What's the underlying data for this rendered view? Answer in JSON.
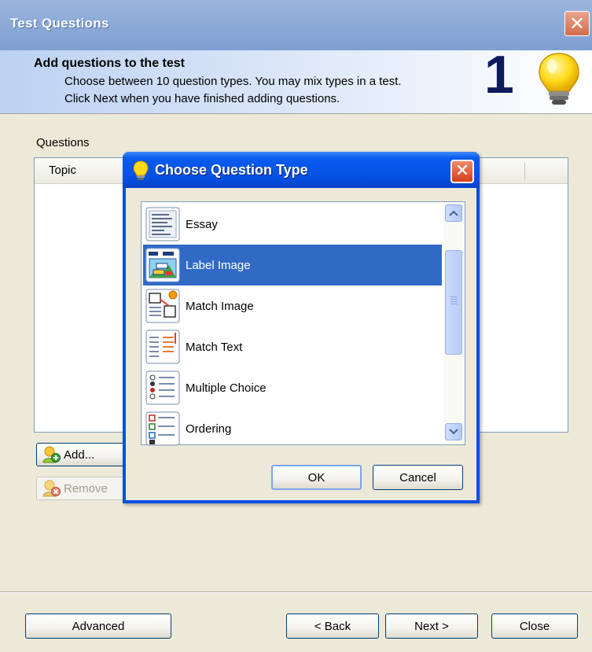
{
  "window": {
    "title": "Test Questions",
    "close_glyph": "✕"
  },
  "header": {
    "title": "Add questions to the test",
    "line1": "Choose between 10 question types. You may mix types in a test.",
    "line2": "Click Next when you have finished adding questions.",
    "step": "1",
    "icon": "lightbulb-icon"
  },
  "questions": {
    "label": "Questions",
    "columns": [
      "Topic"
    ]
  },
  "buttons": {
    "add": "Add...",
    "remove": "Remove",
    "advanced": "Advanced",
    "back": "< Back",
    "next": "Next >",
    "close": "Close"
  },
  "dialog": {
    "title": "Choose Question Type",
    "close_glyph": "✕",
    "types": [
      {
        "label": "Essay",
        "icon": "essay-icon"
      },
      {
        "label": "Label Image",
        "icon": "label-image-icon",
        "selected": true
      },
      {
        "label": "Match Image",
        "icon": "match-image-icon"
      },
      {
        "label": "Match Text",
        "icon": "match-text-icon"
      },
      {
        "label": "Multiple Choice",
        "icon": "multiple-choice-icon"
      },
      {
        "label": "Ordering",
        "icon": "ordering-icon"
      }
    ],
    "ok": "OK",
    "cancel": "Cancel"
  },
  "colors": {
    "selection": "#316ac5",
    "dialog_title": "#0551e4",
    "banner": "#bcd1f2",
    "step_number": "#0d1a5c"
  }
}
